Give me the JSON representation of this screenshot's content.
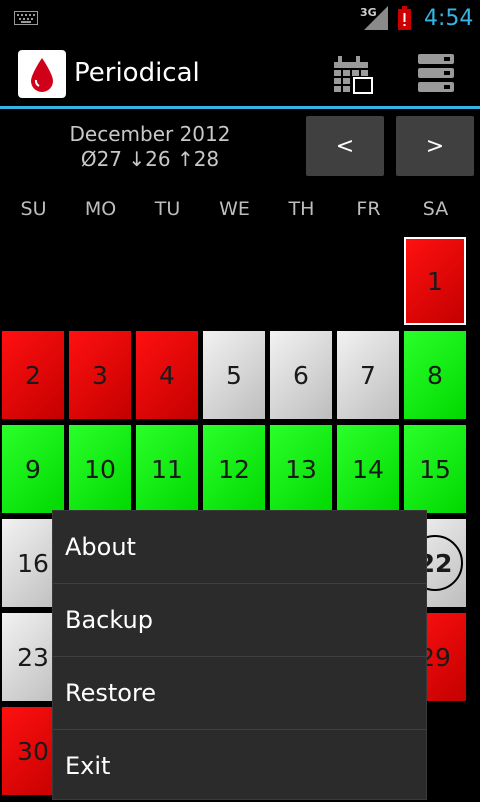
{
  "status_bar": {
    "time": "4:54",
    "network": "3G"
  },
  "app": {
    "title": "Periodical"
  },
  "month": {
    "label": "December 2012",
    "stats": "Ø27 ↓26 ↑28"
  },
  "nav": {
    "prev_label": "<",
    "next_label": ">"
  },
  "weekdays": [
    "SU",
    "MO",
    "TU",
    "WE",
    "TH",
    "FR",
    "SA"
  ],
  "days": [
    {
      "label": "1",
      "type": "red",
      "selected": true
    },
    {
      "label": "2",
      "type": "red"
    },
    {
      "label": "3",
      "type": "red"
    },
    {
      "label": "4",
      "type": "red"
    },
    {
      "label": "5",
      "type": "white"
    },
    {
      "label": "6",
      "type": "white"
    },
    {
      "label": "7",
      "type": "white"
    },
    {
      "label": "8",
      "type": "green"
    },
    {
      "label": "9",
      "type": "green"
    },
    {
      "label": "10",
      "type": "green"
    },
    {
      "label": "11",
      "type": "green"
    },
    {
      "label": "12",
      "type": "green"
    },
    {
      "label": "13",
      "type": "green"
    },
    {
      "label": "14",
      "type": "green"
    },
    {
      "label": "15",
      "type": "green"
    },
    {
      "label": "16",
      "type": "white"
    },
    {
      "label": "22",
      "type": "white",
      "today": true
    },
    {
      "label": "23",
      "type": "white"
    },
    {
      "label": "29",
      "type": "red"
    },
    {
      "label": "30",
      "type": "red"
    }
  ],
  "menu": {
    "items": [
      "About",
      "Backup",
      "Restore",
      "Exit"
    ]
  },
  "colors": {
    "accent": "#33b5e5",
    "period_red": "#e00000",
    "fertile_green": "#00e600",
    "normal_grey": "#d8d8d8"
  }
}
